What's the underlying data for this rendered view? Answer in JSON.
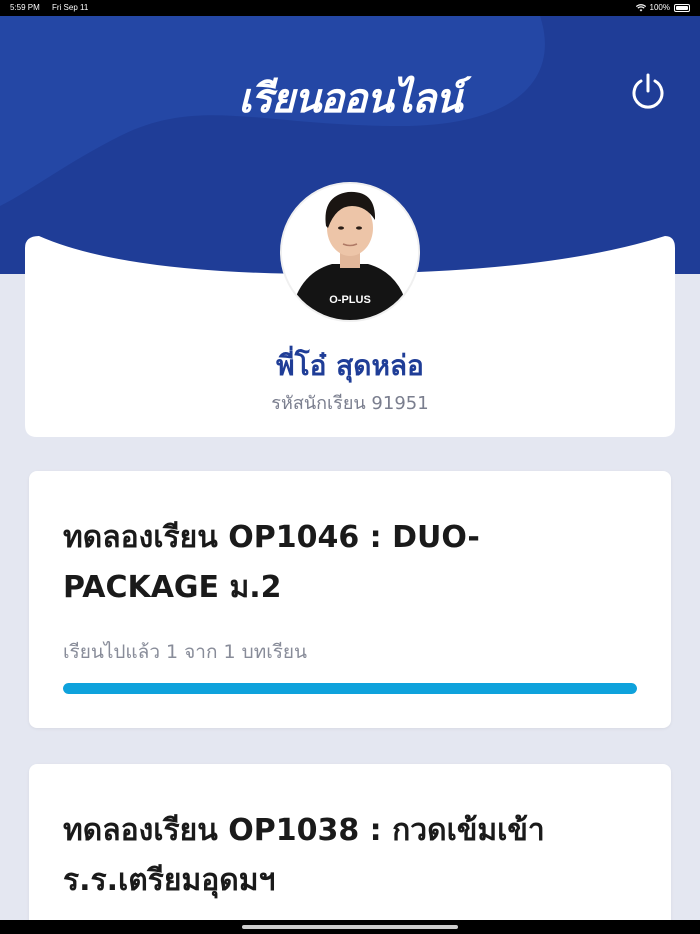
{
  "status_bar": {
    "time": "5:59 PM",
    "date": "Fri Sep 11",
    "battery": "100%"
  },
  "header": {
    "title": "เรียนออนไลน์",
    "power_icon": "power-icon",
    "bg_color": "#1f3d97"
  },
  "profile": {
    "name": "พี่โอ๋ สุดหล่อ",
    "student_id": "รหัสนักเรียน 91951",
    "avatar_shirt_text": "O-PLUS"
  },
  "courses": [
    {
      "title": "ทดลองเรียน OP1046 : DUO-PACKAGE ม.2",
      "progress_text": "เรียนไปแล้ว 1 จาก 1 บทเรียน",
      "progress": 1.0
    },
    {
      "title": "ทดลองเรียน OP1038 : กวดเข้มเข้า ร.ร.เตรียมอุดมฯ"
    }
  ],
  "colors": {
    "accent": "#1f3d97",
    "progress": "#0ea2dc",
    "background": "#e4e7f1"
  }
}
